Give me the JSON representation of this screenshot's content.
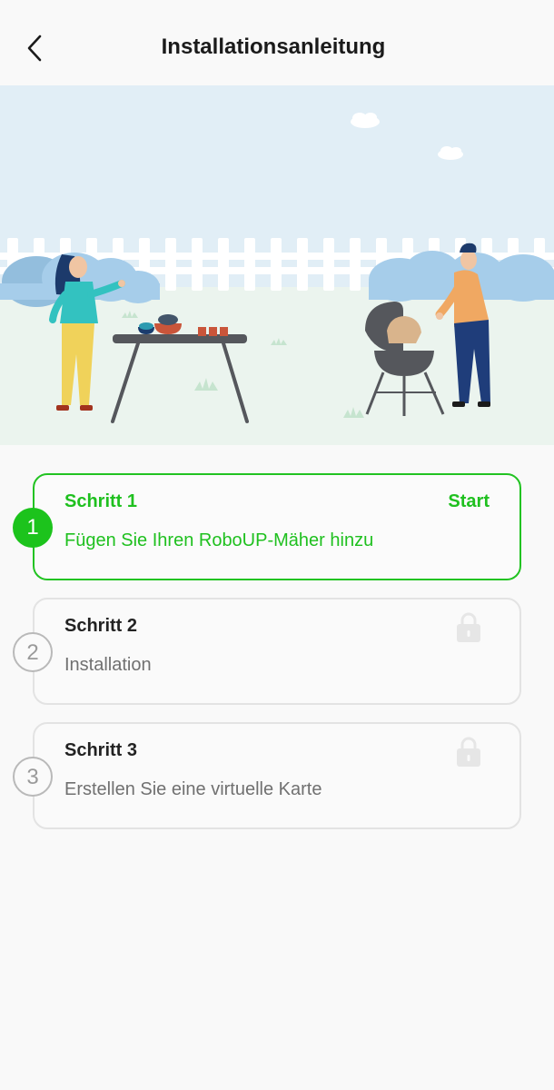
{
  "header": {
    "title": "Installationsanleitung",
    "back_icon": "chevron-left-icon"
  },
  "hero": {
    "illustration": "barbecue-garden-illustration"
  },
  "steps": [
    {
      "number": "1",
      "title": "Schritt 1",
      "description": "Fügen Sie Ihren RoboUP-Mäher hinzu",
      "action": "Start",
      "state": "active"
    },
    {
      "number": "2",
      "title": "Schritt 2",
      "description": "Installation",
      "icon": "lock-icon",
      "state": "locked"
    },
    {
      "number": "3",
      "title": "Schritt 3",
      "description": "Erstellen Sie eine virtuelle Karte",
      "icon": "lock-icon",
      "state": "locked"
    }
  ],
  "colors": {
    "accent": "#1fc01f",
    "locked_border": "#e3e3e3",
    "locked_text": "#707070"
  }
}
